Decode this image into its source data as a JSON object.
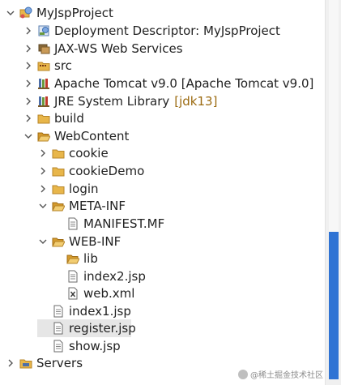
{
  "tree": {
    "project": {
      "label": "MyJspProject",
      "icon": "web-project-icon"
    },
    "deployment_descriptor": {
      "label": "Deployment Descriptor: MyJspProject",
      "icon": "deployment-descriptor-icon"
    },
    "jaxws": {
      "label": "JAX-WS Web Services",
      "icon": "web-services-icon"
    },
    "src": {
      "label": "src",
      "icon": "source-folder-icon"
    },
    "tomcat": {
      "label": "Apache Tomcat v9.0 [Apache Tomcat v9.0]",
      "icon": "library-icon"
    },
    "jre": {
      "label": "JRE System Library",
      "decoration": "[jdk13]",
      "icon": "library-icon"
    },
    "build": {
      "label": "build",
      "icon": "folder-icon"
    },
    "webcontent": {
      "label": "WebContent",
      "icon": "folder-open-icon"
    },
    "cookie": {
      "label": "cookie",
      "icon": "folder-icon"
    },
    "cookieDemo": {
      "label": "cookieDemo",
      "icon": "folder-icon"
    },
    "login": {
      "label": "login",
      "icon": "folder-icon"
    },
    "metainf": {
      "label": "META-INF",
      "icon": "folder-open-icon"
    },
    "manifest": {
      "label": "MANIFEST.MF",
      "icon": "text-file-icon"
    },
    "webinf": {
      "label": "WEB-INF",
      "icon": "folder-open-icon"
    },
    "lib": {
      "label": "lib",
      "icon": "folder-open-icon"
    },
    "index2": {
      "label": "index2.jsp",
      "icon": "jsp-file-icon"
    },
    "webxml": {
      "label": "web.xml",
      "icon": "xml-file-icon"
    },
    "index1": {
      "label": "index1.jsp",
      "icon": "jsp-file-icon"
    },
    "register": {
      "label": "register.jsp",
      "icon": "jsp-file-icon",
      "selected": true
    },
    "show": {
      "label": "show.jsp",
      "icon": "jsp-file-icon"
    },
    "servers": {
      "label": "Servers",
      "icon": "folder-icon"
    }
  },
  "watermark": {
    "text": "@稀土掘金技术社区"
  },
  "colors": {
    "folder": "#e8b64a",
    "decoration": "#9b6a10",
    "selection": "#e6e6e6",
    "scroll_thumb": "#2f73d4"
  }
}
